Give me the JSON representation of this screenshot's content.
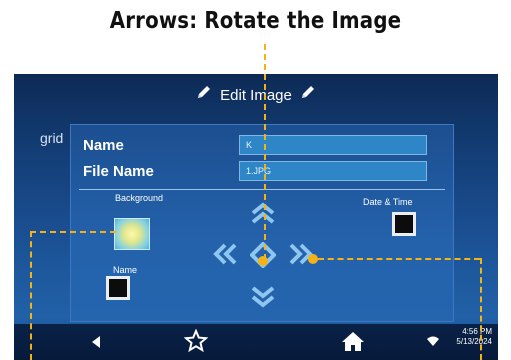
{
  "caption": "Arrows: Rotate the Image",
  "screen": {
    "title": "Edit Image",
    "grid_label": "grid",
    "fields": {
      "name_label": "Name",
      "name_value": "K",
      "file_name_label": "File Name",
      "file_name_value": "1.JPG"
    },
    "background_label": "Background",
    "date_time_label": "Date & Time",
    "name_checkbox_label": "Name",
    "arrows": {
      "up": "»",
      "down": "»",
      "left": "«",
      "right": "»"
    },
    "status": {
      "time": "4:56 PM",
      "date": "5/13/2024"
    }
  },
  "colors": {
    "annotation": "#f3b215",
    "arrow": "#8fc6ee",
    "screen_bg": "#1a4f92"
  }
}
